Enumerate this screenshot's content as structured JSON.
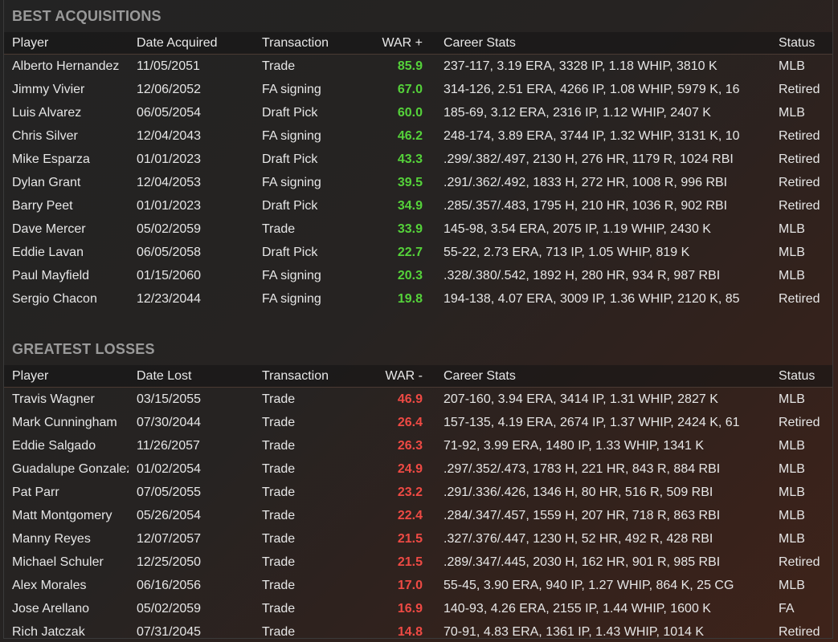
{
  "acquisitions": {
    "title": "BEST ACQUISITIONS",
    "headers": {
      "player": "Player",
      "date": "Date Acquired",
      "transaction": "Transaction",
      "war": "WAR +",
      "stats": "Career Stats",
      "status": "Status"
    },
    "war_color": "#55d23a",
    "rows": [
      {
        "player": "Alberto Hernandez",
        "date": "11/05/2051",
        "transaction": "Trade",
        "war": "85.9",
        "stats": "237-117, 3.19 ERA, 3328 IP, 1.18 WHIP, 3810 K",
        "status": "MLB"
      },
      {
        "player": "Jimmy Vivier",
        "date": "12/06/2052",
        "transaction": "FA signing",
        "war": "67.0",
        "stats": "314-126, 2.51 ERA, 4266 IP, 1.08 WHIP, 5979 K, 16",
        "status": "Retired"
      },
      {
        "player": "Luis Alvarez",
        "date": "06/05/2054",
        "transaction": "Draft Pick",
        "war": "60.0",
        "stats": "185-69, 3.12 ERA, 2316 IP, 1.12 WHIP, 2407 K",
        "status": "MLB"
      },
      {
        "player": "Chris Silver",
        "date": "12/04/2043",
        "transaction": "FA signing",
        "war": "46.2",
        "stats": "248-174, 3.89 ERA, 3744 IP, 1.32 WHIP, 3131 K, 10",
        "status": "Retired"
      },
      {
        "player": "Mike Esparza",
        "date": "01/01/2023",
        "transaction": "Draft Pick",
        "war": "43.3",
        "stats": ".299/.382/.497, 2130 H, 276 HR, 1179 R, 1024 RBI",
        "status": "Retired"
      },
      {
        "player": "Dylan Grant",
        "date": "12/04/2053",
        "transaction": "FA signing",
        "war": "39.5",
        "stats": ".291/.362/.492, 1833 H, 272 HR, 1008 R, 996 RBI",
        "status": "Retired"
      },
      {
        "player": "Barry Peet",
        "date": "01/01/2023",
        "transaction": "Draft Pick",
        "war": "34.9",
        "stats": ".285/.357/.483, 1795 H, 210 HR, 1036 R, 902 RBI",
        "status": "Retired"
      },
      {
        "player": "Dave Mercer",
        "date": "05/02/2059",
        "transaction": "Trade",
        "war": "33.9",
        "stats": "145-98, 3.54 ERA, 2075 IP, 1.19 WHIP, 2430 K",
        "status": "MLB"
      },
      {
        "player": "Eddie Lavan",
        "date": "06/05/2058",
        "transaction": "Draft Pick",
        "war": "22.7",
        "stats": "55-22, 2.73 ERA, 713 IP, 1.05 WHIP, 819 K",
        "status": "MLB"
      },
      {
        "player": "Paul Mayfield",
        "date": "01/15/2060",
        "transaction": "FA signing",
        "war": "20.3",
        "stats": ".328/.380/.542, 1892 H, 280 HR, 934 R, 987 RBI",
        "status": "MLB"
      },
      {
        "player": "Sergio Chacon",
        "date": "12/23/2044",
        "transaction": "FA signing",
        "war": "19.8",
        "stats": "194-138, 4.07 ERA, 3009 IP, 1.36 WHIP, 2120 K, 85",
        "status": "Retired"
      }
    ]
  },
  "losses": {
    "title": "GREATEST LOSSES",
    "headers": {
      "player": "Player",
      "date": "Date Lost",
      "transaction": "Transaction",
      "war": "WAR -",
      "stats": "Career Stats",
      "status": "Status"
    },
    "war_color": "#ee4a44",
    "rows": [
      {
        "player": "Travis Wagner",
        "date": "03/15/2055",
        "transaction": "Trade",
        "war": "46.9",
        "stats": "207-160, 3.94 ERA, 3414 IP, 1.31 WHIP, 2827 K",
        "status": "MLB"
      },
      {
        "player": "Mark Cunningham",
        "date": "07/30/2044",
        "transaction": "Trade",
        "war": "26.4",
        "stats": "157-135, 4.19 ERA, 2674 IP, 1.37 WHIP, 2424 K, 61",
        "status": "Retired"
      },
      {
        "player": "Eddie Salgado",
        "date": "11/26/2057",
        "transaction": "Trade",
        "war": "26.3",
        "stats": "71-92, 3.99 ERA, 1480 IP, 1.33 WHIP, 1341 K",
        "status": "MLB"
      },
      {
        "player": "Guadalupe Gonzalez",
        "date": "01/02/2054",
        "transaction": "Trade",
        "war": "24.9",
        "stats": ".297/.352/.473, 1783 H, 221 HR, 843 R, 884 RBI",
        "status": "MLB"
      },
      {
        "player": "Pat Parr",
        "date": "07/05/2055",
        "transaction": "Trade",
        "war": "23.2",
        "stats": ".291/.336/.426, 1346 H, 80 HR, 516 R, 509 RBI",
        "status": "MLB"
      },
      {
        "player": "Matt Montgomery",
        "date": "05/26/2054",
        "transaction": "Trade",
        "war": "22.4",
        "stats": ".284/.347/.457, 1559 H, 207 HR, 718 R, 863 RBI",
        "status": "MLB"
      },
      {
        "player": "Manny Reyes",
        "date": "12/07/2057",
        "transaction": "Trade",
        "war": "21.5",
        "stats": ".327/.376/.447, 1230 H, 52 HR, 492 R, 428 RBI",
        "status": "MLB"
      },
      {
        "player": "Michael Schuler",
        "date": "12/25/2050",
        "transaction": "Trade",
        "war": "21.5",
        "stats": ".289/.347/.445, 2030 H, 162 HR, 901 R, 985 RBI",
        "status": "Retired"
      },
      {
        "player": "Alex Morales",
        "date": "06/16/2056",
        "transaction": "Trade",
        "war": "17.0",
        "stats": "55-45, 3.90 ERA, 940 IP, 1.27 WHIP, 864 K, 25 CG",
        "status": "MLB"
      },
      {
        "player": "Jose Arellano",
        "date": "05/02/2059",
        "transaction": "Trade",
        "war": "16.9",
        "stats": "140-93, 4.26 ERA, 2155 IP, 1.44 WHIP, 1600 K",
        "status": "FA"
      },
      {
        "player": "Rich Jatczak",
        "date": "07/31/2045",
        "transaction": "Trade",
        "war": "14.8",
        "stats": "70-91, 4.83 ERA, 1361 IP, 1.43 WHIP, 1014 K",
        "status": "Retired"
      }
    ]
  }
}
